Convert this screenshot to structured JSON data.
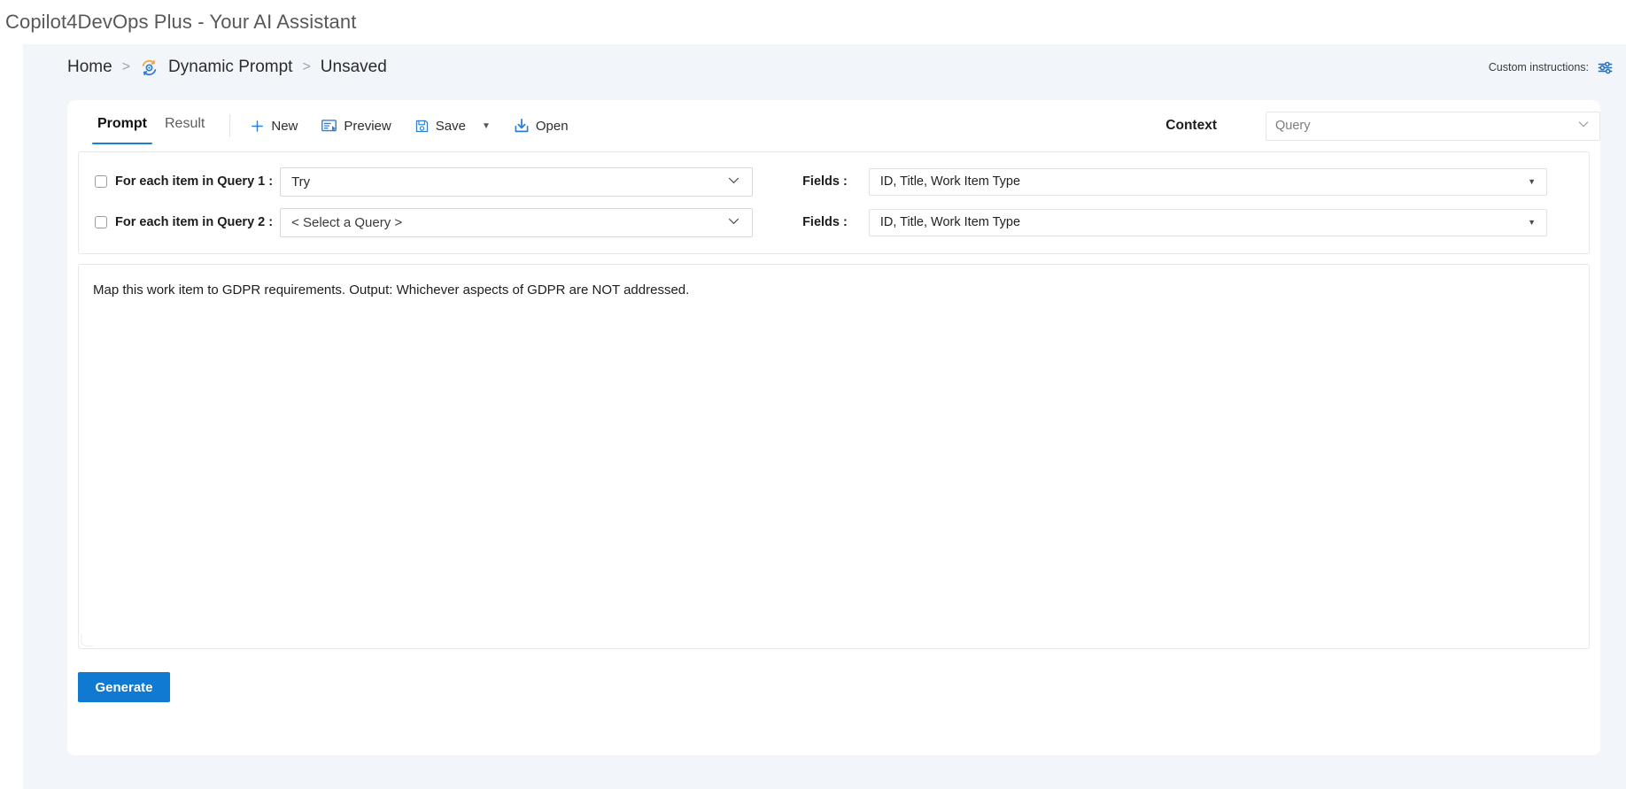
{
  "app": {
    "title": "Copilot4DevOps Plus - Your AI Assistant"
  },
  "breadcrumb": {
    "home": "Home",
    "sep1": ">",
    "dynamic_prompt": "Dynamic Prompt",
    "sep2": ">",
    "current": "Unsaved",
    "icon": "dynamic-prompt-sync-icon"
  },
  "custom_instructions": {
    "label": "Custom instructions:",
    "icon": "sliders-icon"
  },
  "toolbar": {
    "tabs": [
      {
        "label": "Prompt",
        "active": true
      },
      {
        "label": "Result",
        "active": false
      }
    ],
    "buttons": [
      {
        "label": "New",
        "icon": "plus-icon"
      },
      {
        "label": "Preview",
        "icon": "preview-icon"
      },
      {
        "label": "Save",
        "icon": "floppy-disk-icon"
      },
      {
        "label": "Open",
        "icon": "open-download-icon"
      }
    ],
    "save_caret": "▼",
    "context_label": "Context",
    "context_value": "Query",
    "context_placeholder": "Query",
    "context_chevron": "chevron-down-icon"
  },
  "queries": [
    {
      "checkbox_checked": false,
      "label": "For each item in Query 1 :",
      "query_value": "Try",
      "fields_label": "Fields :",
      "fields_value": "ID, Title, Work Item Type"
    },
    {
      "checkbox_checked": false,
      "label": "For each item in Query 2 :",
      "query_value": "< Select a Query >",
      "fields_label": "Fields :",
      "fields_value": "ID, Title, Work Item Type"
    }
  ],
  "prompt": {
    "text": "Map this work item to GDPR requirements. Output: Whichever aspects of GDPR are NOT addressed.",
    "placeholder": ""
  },
  "actions": {
    "generate_label": "Generate"
  },
  "colors": {
    "accent_blue": "#1079d2",
    "tab_underline": "#1b7fd4",
    "canvas_bg": "#f2f6fb",
    "card_bg": "#ffffff",
    "icon_orange": "#f2a33c"
  }
}
